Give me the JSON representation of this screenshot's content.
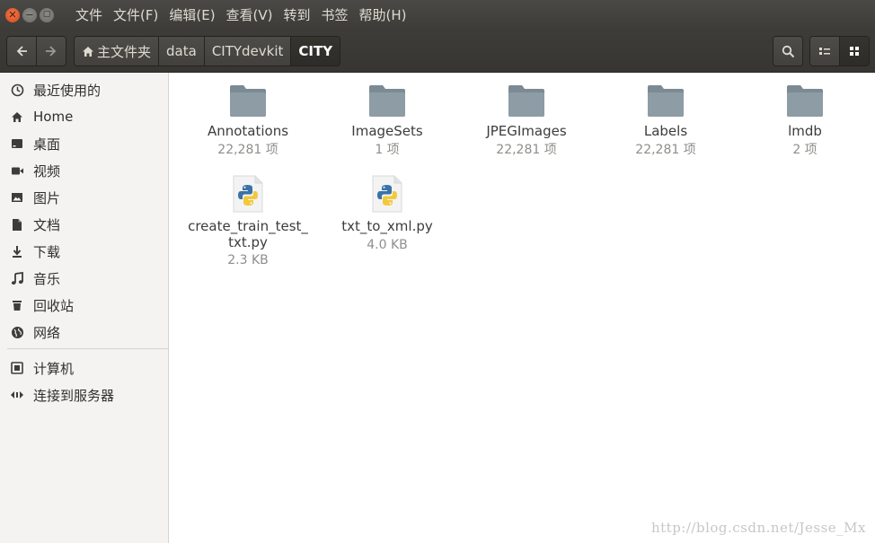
{
  "menu": [
    "文件",
    "文件(F)",
    "编辑(E)",
    "查看(V)",
    "转到",
    "书签",
    "帮助(H)"
  ],
  "toolbar": {
    "breadcrumbs": [
      {
        "label": "主文件夹",
        "icon": "home-icon"
      },
      {
        "label": "data"
      },
      {
        "label": "CITYdevkit"
      },
      {
        "label": "CITY",
        "active": true
      }
    ]
  },
  "sidebar": {
    "items": [
      {
        "label": "最近使用的",
        "icon": "clock-icon"
      },
      {
        "label": "Home",
        "icon": "home-icon"
      },
      {
        "label": "桌面",
        "icon": "desktop-icon"
      },
      {
        "label": "视频",
        "icon": "video-icon"
      },
      {
        "label": "图片",
        "icon": "picture-icon"
      },
      {
        "label": "文档",
        "icon": "document-icon"
      },
      {
        "label": "下载",
        "icon": "download-icon"
      },
      {
        "label": "音乐",
        "icon": "music-icon"
      },
      {
        "label": "回收站",
        "icon": "trash-icon"
      },
      {
        "label": "网络",
        "icon": "network-icon"
      },
      {
        "label": "计算机",
        "icon": "computer-icon"
      },
      {
        "label": "连接到服务器",
        "icon": "connect-server-icon"
      }
    ]
  },
  "files": [
    {
      "name": "Annotations",
      "info": "22,281 项",
      "type": "folder"
    },
    {
      "name": "ImageSets",
      "info": "1 项",
      "type": "folder"
    },
    {
      "name": "JPEGImages",
      "info": "22,281 项",
      "type": "folder"
    },
    {
      "name": "Labels",
      "info": "22,281 项",
      "type": "folder"
    },
    {
      "name": "lmdb",
      "info": "2 项",
      "type": "folder"
    },
    {
      "name": "create_train_test_\ntxt.py",
      "info": "2.3 KB",
      "type": "python"
    },
    {
      "name": "txt_to_xml.py",
      "info": "4.0 KB",
      "type": "python"
    }
  ],
  "watermark": "http://blog.csdn.net/Jesse_Mx",
  "colors": {
    "titlebar": "#3d3c38",
    "close_button": "#e25a2c",
    "folder": "#8b9aa3",
    "sidebar_bg": "#f4f3f2"
  }
}
